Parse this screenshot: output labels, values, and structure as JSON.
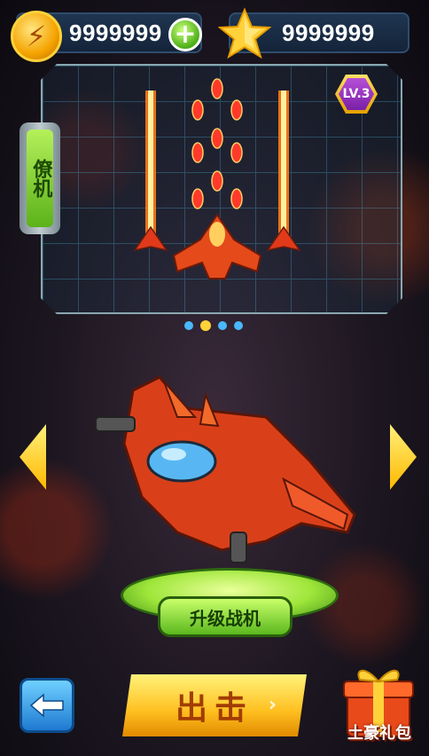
{
  "resources": {
    "coins": "9999999",
    "stars": "9999999",
    "add_label": "+"
  },
  "preview": {
    "level": "LV.3",
    "wingman_tab": "僚机",
    "page_count": 4,
    "active_page": 1
  },
  "actions": {
    "upgrade": "升级战机",
    "launch": "出击",
    "gift": "土豪礼包"
  },
  "colors": {
    "coin": "#f5a300",
    "upgrade_green": "#5bb81e",
    "launch_yellow": "#ffbf1f",
    "back_blue": "#1f7ad1",
    "panel_border": "#8aa8b0"
  },
  "icons": {
    "coin": "lightning-coin-icon",
    "star": "star-icon",
    "back": "back-arrow-icon",
    "gift": "gift-box-icon"
  }
}
